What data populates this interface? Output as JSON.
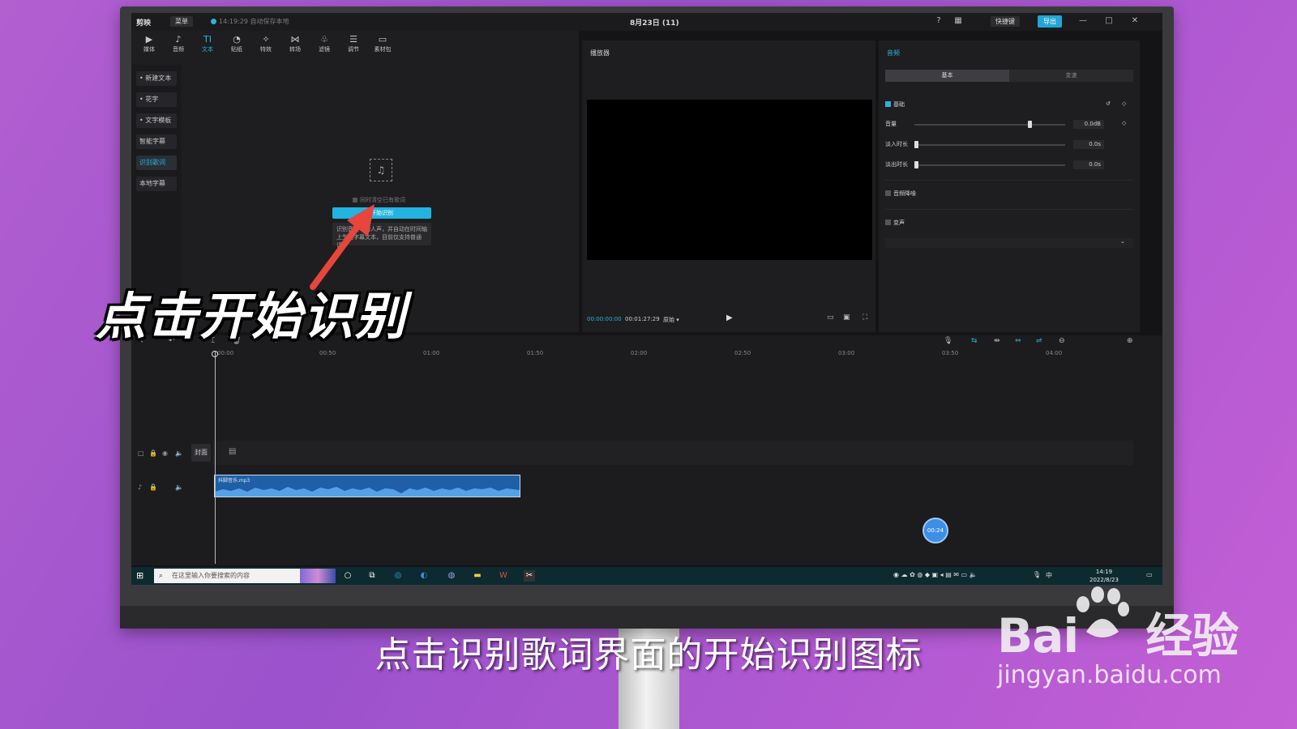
{
  "app": {
    "logo": "剪映",
    "menu_label": "菜单",
    "autosave": "14:19:29 自动保存本地",
    "project_title": "8月23日 (11)",
    "shortcut_label": "快捷键",
    "export_label": "导出"
  },
  "toolbar": {
    "items": [
      {
        "label": "媒体",
        "icon": "▶"
      },
      {
        "label": "音频",
        "icon": "♪"
      },
      {
        "label": "文本",
        "icon": "TI"
      },
      {
        "label": "贴纸",
        "icon": "◔"
      },
      {
        "label": "特效",
        "icon": "✧"
      },
      {
        "label": "转场",
        "icon": "⋈"
      },
      {
        "label": "滤镜",
        "icon": "♧"
      },
      {
        "label": "调节",
        "icon": "☰"
      },
      {
        "label": "素材包",
        "icon": "▭"
      }
    ],
    "active_index": 2
  },
  "sidenav": {
    "items": [
      "• 新建文本",
      "• 花字",
      "• 文字模板",
      "智能字幕",
      "识别歌词",
      "本地字幕"
    ],
    "active_index": 4
  },
  "lyrics": {
    "checkbox_label": "同时清空已有歌词",
    "start_button": "开始识别",
    "tip": "识别音频中的人声，并自动在时间轴上生成字幕文本，目前仅支持普通话。"
  },
  "player": {
    "title": "播放器",
    "current_time": "00:00:00:00",
    "duration": "00:01:27:29",
    "ratio_label": "原始"
  },
  "inspector": {
    "title": "音频",
    "tabs": [
      "基本",
      "变速"
    ],
    "basic_section": "基础",
    "volume_label": "音量",
    "volume_value": "0.0dB",
    "volume_level": 0.75,
    "fade_in_label": "淡入时长",
    "fade_in_value": "0.0s",
    "fade_out_label": "淡出时长",
    "fade_out_value": "0.0s",
    "denoise_label": "音频降噪",
    "voice_change_label": "变声"
  },
  "timeline": {
    "ruler": [
      "00:00",
      "00:50",
      "01:00",
      "01:50",
      "02:00",
      "02:50",
      "03:00",
      "03:50",
      "04:00"
    ],
    "cover_label": "封面",
    "audio_clip_name": "抖脚音乐.mp3",
    "time_bubble": "00:24"
  },
  "taskbar": {
    "search_placeholder": "在这里输入你要搜索的内容",
    "clock_time": "14:19",
    "clock_date": "2022/8/23",
    "ime": "中"
  },
  "overlay": {
    "big_caption": "点击开始识别",
    "subtitle": "点击识别歌词界面的开始识别图标",
    "watermark_main": "Bai",
    "watermark_main2": "经验",
    "watermark_url": "jingyan.baidu.com"
  }
}
